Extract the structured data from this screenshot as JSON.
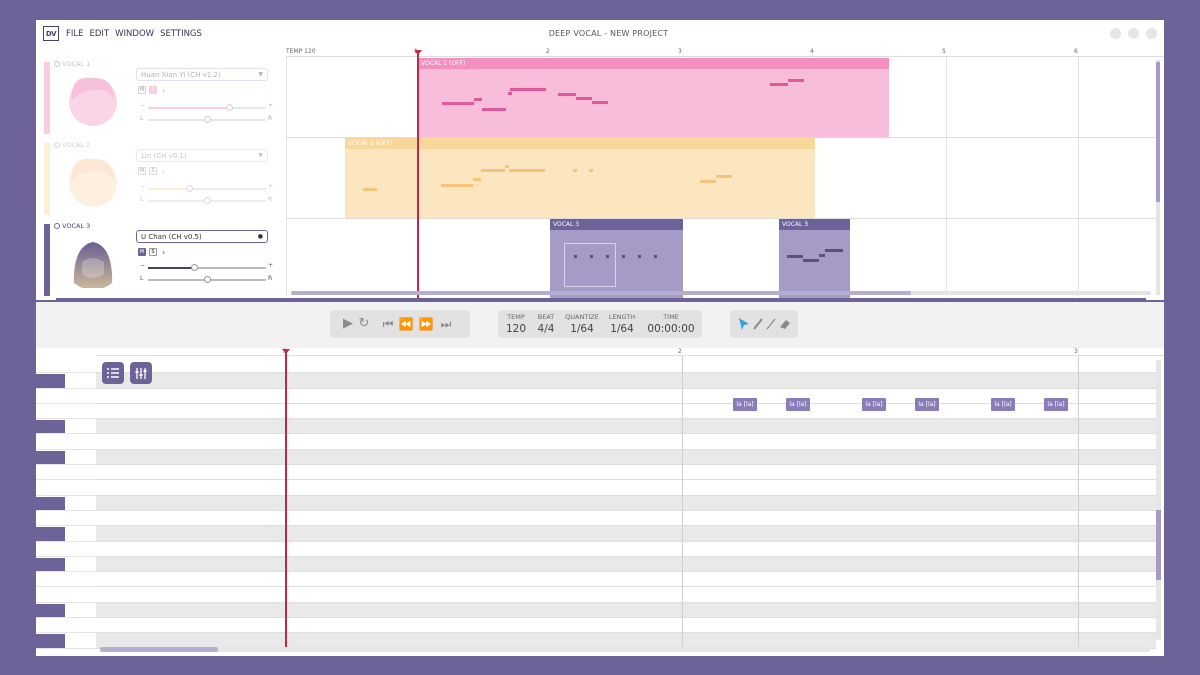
{
  "window": {
    "logo": "DV",
    "title": "DEEP VOCAL - NEW PROJECT",
    "menu": [
      "FILE",
      "EDIT",
      "WINDOW",
      "SETTINGS"
    ]
  },
  "arrangement": {
    "tempo_marker": "TEMP 120",
    "bars": [
      "1",
      "2",
      "3",
      "4",
      "5",
      "6"
    ],
    "tracks": [
      {
        "name": "VOCAL 1",
        "voice": "Huan Xian Yi (CH v1.2)",
        "mute": "M",
        "solo": "S",
        "color": "#f48fc0",
        "active": false
      },
      {
        "name": "VOCAL 2",
        "voice": "Lin (CH v0.1)",
        "mute": "M",
        "solo": "S",
        "color": "#f8d79a",
        "active": false
      },
      {
        "name": "VOCAL 3",
        "voice": "U Chan (CH v0.5)",
        "mute": "M",
        "solo": "S",
        "color": "#6e6398",
        "active": true
      }
    ],
    "regions": [
      {
        "label": "VOCAL 1 (OFF)",
        "track": 0
      },
      {
        "label": "VOCAL 2 (OFF)",
        "track": 1
      },
      {
        "label": "VOCAL 3",
        "track": 2
      },
      {
        "label": "VOCAL 3",
        "track": 2
      }
    ],
    "pan_left": "L",
    "pan_right": "R",
    "vol_minus": "−",
    "vol_plus": "+"
  },
  "transport": {
    "tempo": {
      "label": "TEMP",
      "value": "120"
    },
    "beat": {
      "label": "BEAT",
      "value": "4/4"
    },
    "quantize": {
      "label": "QUANTIZE",
      "value": "1/64"
    },
    "length": {
      "label": "LENGTH",
      "value": "1/64"
    },
    "time": {
      "label": "TIME",
      "value": "00:00:00"
    }
  },
  "piano_roll": {
    "bars": [
      "1",
      "2",
      "3"
    ],
    "notes": [
      "la [la]",
      "la [la]",
      "la [la]",
      "la [la]",
      "la [la]",
      "la [la]"
    ]
  },
  "colors": {
    "accent": "#6e6398",
    "vocal1": "#f48fc0",
    "vocal2": "#f8d79a",
    "vocal3": "#8a7cb8",
    "playhead": "#c0284a"
  }
}
